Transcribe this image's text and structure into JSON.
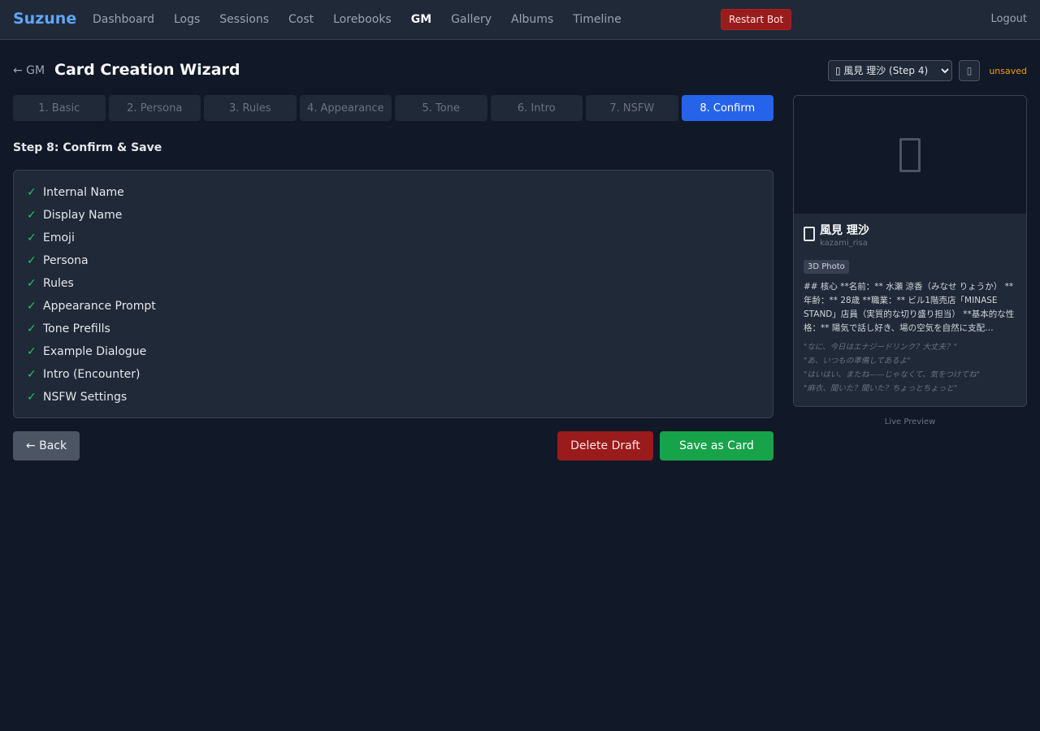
{
  "app": {
    "brand": "Suzune",
    "nav": [
      "Dashboard",
      "Logs",
      "Sessions",
      "Cost",
      "Lorebooks",
      "GM",
      "Gallery",
      "Albums",
      "Timeline"
    ],
    "active_nav": "GM",
    "restart_label": "Restart Bot",
    "logout_label": "Logout"
  },
  "header": {
    "back_label": "← GM",
    "title": "Card Creation Wizard",
    "draft_select_value": "▯ 風見 理沙 (Step 4)",
    "status": "unsaved"
  },
  "steps": [
    "1. Basic",
    "2. Persona",
    "3. Rules",
    "4. Appearance",
    "5. Tone",
    "6. Intro",
    "7. NSFW",
    "8. Confirm"
  ],
  "active_step": 7,
  "confirm": {
    "heading": "Step 8: Confirm & Save",
    "check_mark": "✓",
    "items": [
      "Internal Name",
      "Display Name",
      "Emoji",
      "Persona",
      "Rules",
      "Appearance Prompt",
      "Tone Prefills",
      "Example Dialogue",
      "Intro (Encounter)",
      "NSFW Settings"
    ]
  },
  "actions": {
    "back_label": "← Back",
    "delete_label": "Delete Draft",
    "save_label": "Save as Card"
  },
  "preview": {
    "name": "風見 理沙",
    "id": "kazami_risa",
    "tag": "3D Photo",
    "persona": "## 核心 **名前：** 水瀬 涼香（みなせ りょうか） **年齢：** 28歳 **職業：** ビル1階売店「MINASE STAND」店員（実質的な切り盛り担当） **基本的な性格：** 陽気で話し好き、場の空気を自然に支配…",
    "quotes": [
      "\"なに、今日はエナジードリンク？大丈夫？\"",
      "\"あ、いつもの準備してあるよ\"",
      "\"はいはい、またね——じゃなくて、気をつけてね\"",
      "\"麻衣、聞いた？聞いた？ちょっとちょっと\""
    ],
    "caption": "Live Preview"
  },
  "colors": {
    "accent": "#2563eb",
    "brand": "#60a5fa",
    "success": "#22c55e",
    "danger": "#991b1b",
    "warning": "#f59e0b"
  }
}
